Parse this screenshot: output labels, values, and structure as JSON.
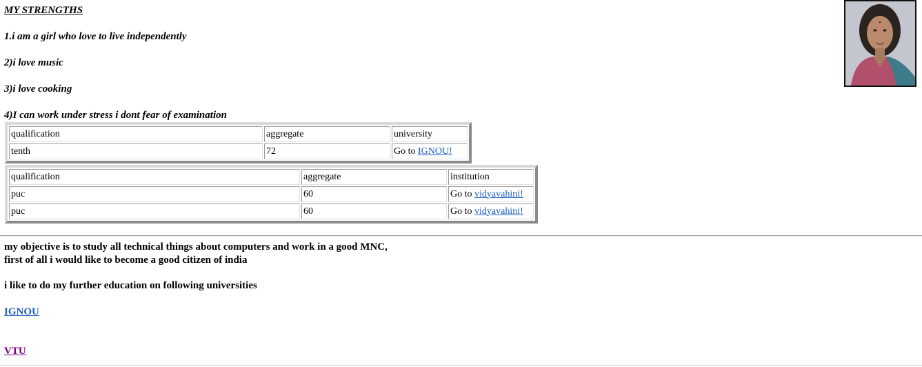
{
  "strengths": {
    "heading": "MY STRENGTHS",
    "items": [
      "1.i am a girl who love to live independently",
      "2)i love music",
      "3)i love cooking",
      "4)I can work under stress i dont fear of examination"
    ]
  },
  "table1": {
    "headers": [
      "qualification",
      "aggregate",
      "university"
    ],
    "row": {
      "qualification": "tenth",
      "aggregate": "72",
      "goto": "Go to",
      "link": "IGNOU!"
    }
  },
  "table2": {
    "headers": [
      "qualification",
      "aggregate",
      "institution"
    ],
    "rows": [
      {
        "qualification": "puc",
        "aggregate": "60",
        "goto": "Go to",
        "link": "vidyavahini!"
      },
      {
        "qualification": "puc",
        "aggregate": "60",
        "goto": "Go to",
        "link": "vidyavahini!"
      }
    ]
  },
  "objective": {
    "line1": "my objective is to study all technical things about computers and work in a good MNC,",
    "line2": "first of all i would like to become a good citizen of india",
    "line3": "i like to do my further education on following universities"
  },
  "universities": {
    "ignou": "IGNOU",
    "vtu": "VTU"
  },
  "colors": {
    "link": "#1a5cc8",
    "visited_link": "#800080"
  }
}
